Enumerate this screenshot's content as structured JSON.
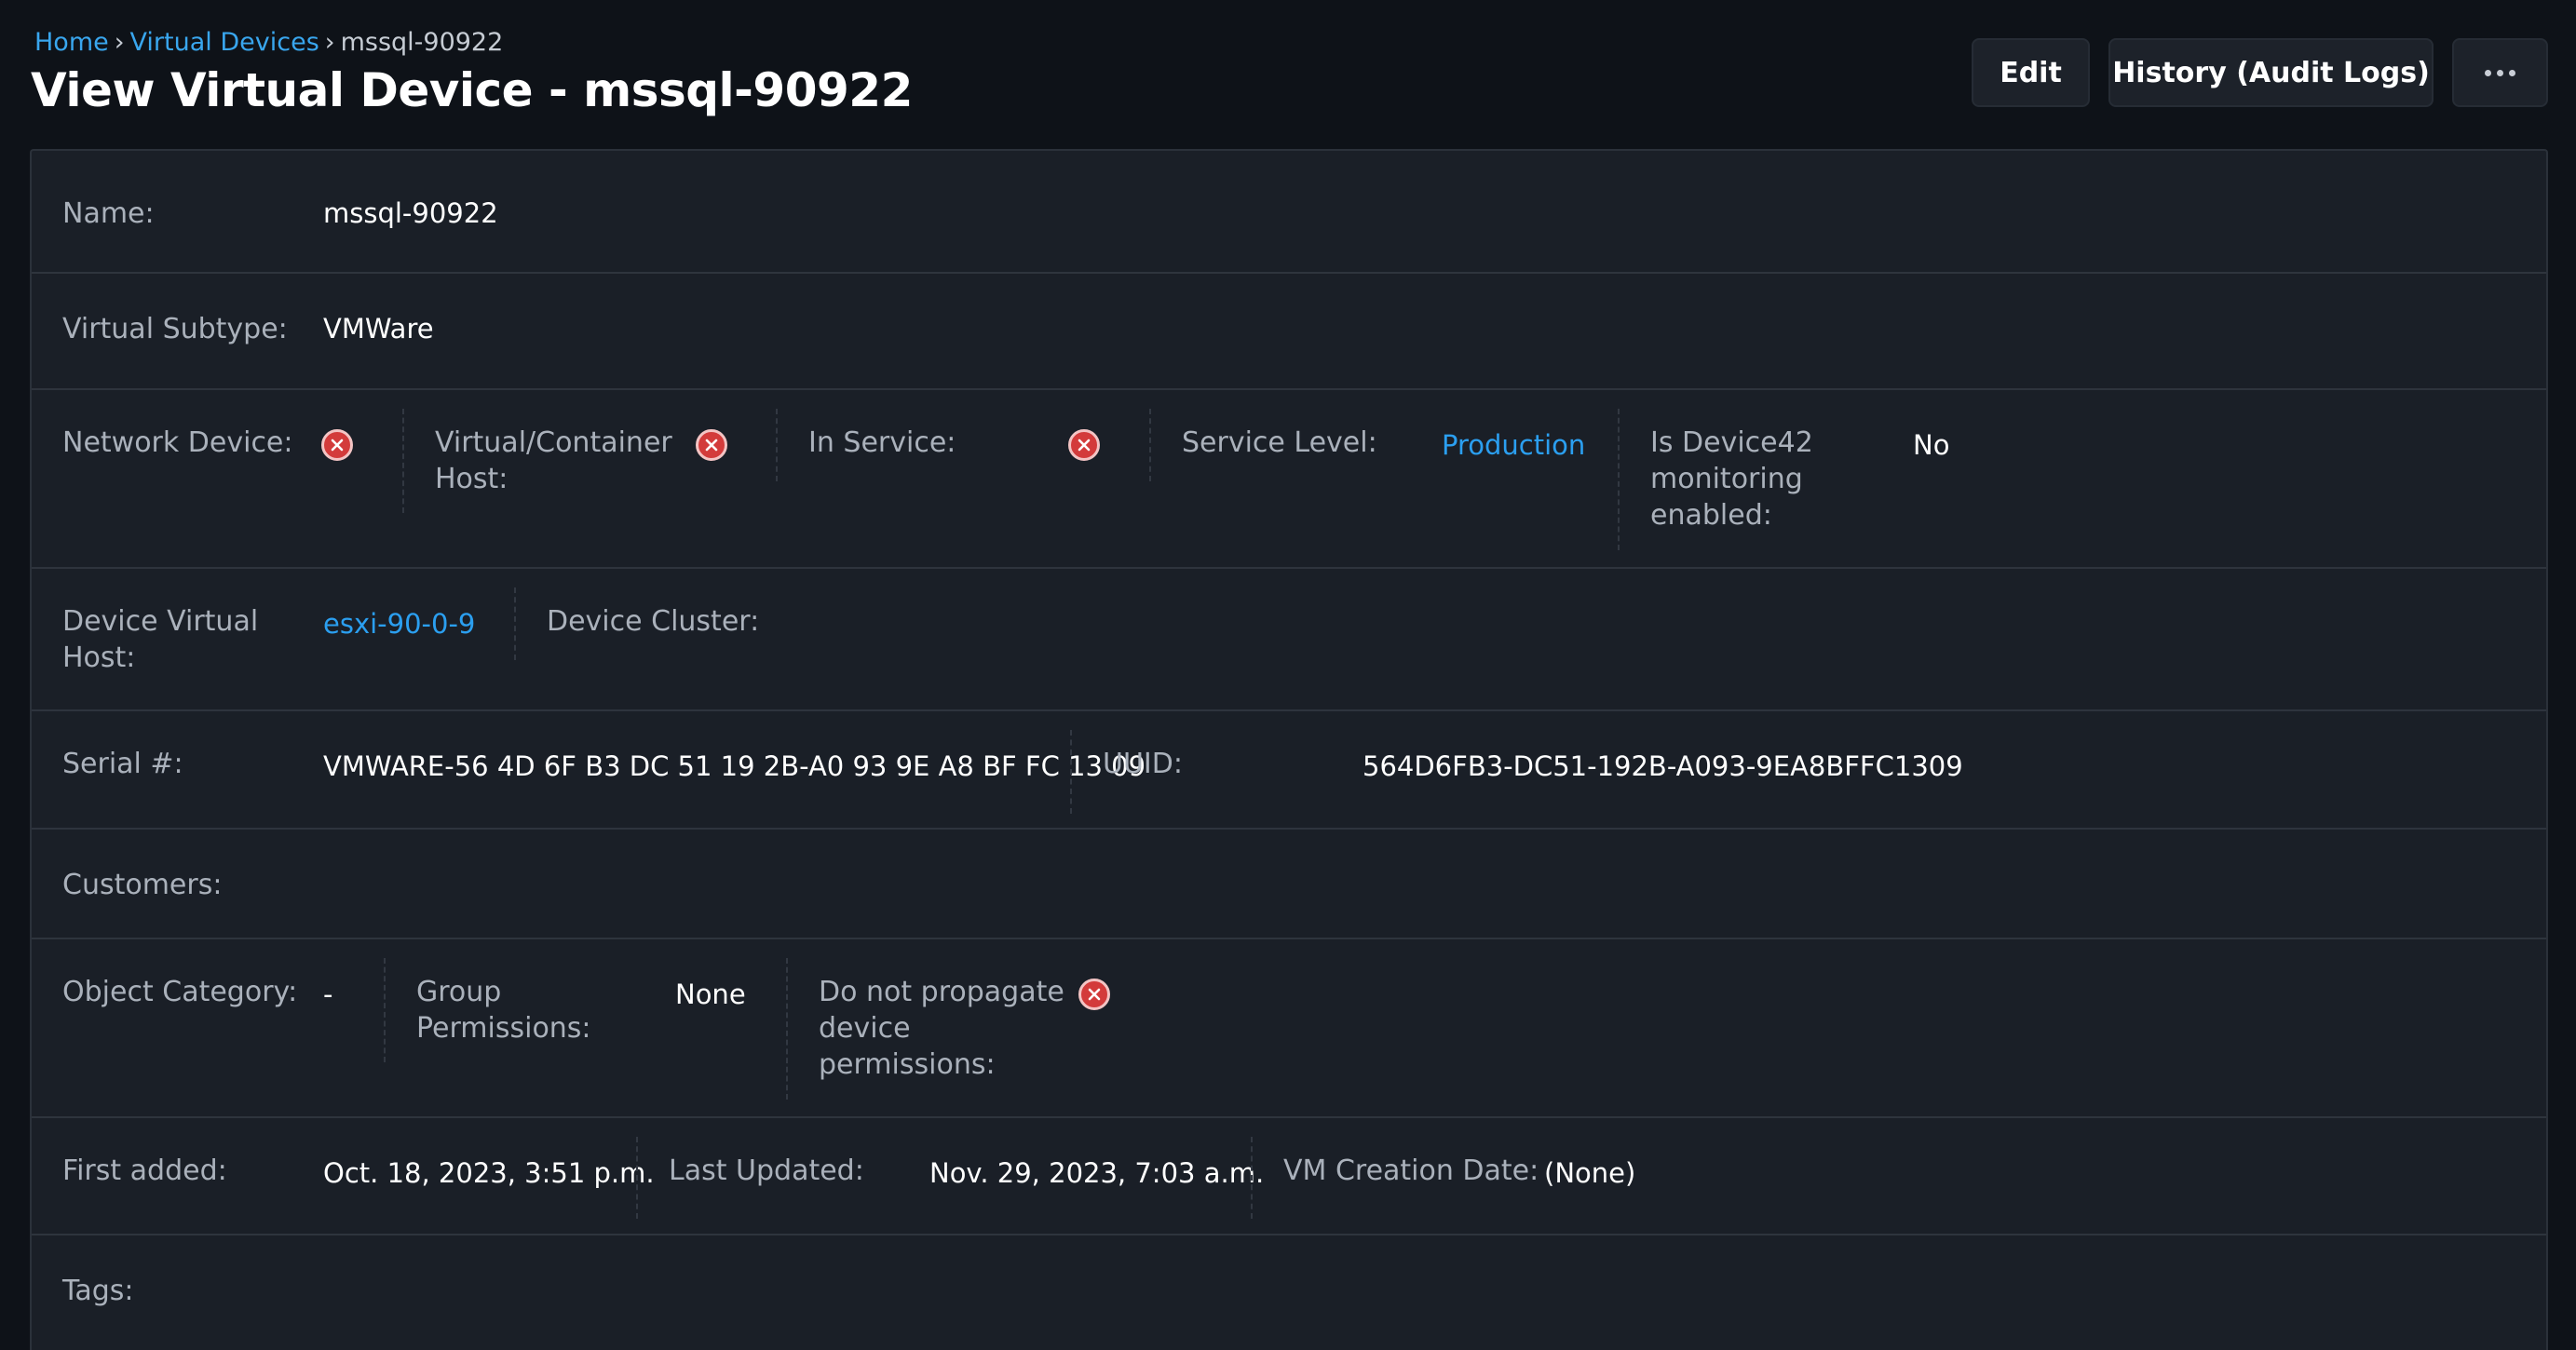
{
  "breadcrumb": {
    "home": "Home",
    "separator": "›",
    "section": "Virtual Devices",
    "current": "mssql-90922"
  },
  "title": "View Virtual Device - mssql-90922",
  "actions": {
    "edit": "Edit",
    "history": "History (Audit Logs)",
    "more_icon": "more-horizontal-icon"
  },
  "fields": {
    "name": {
      "label": "Name:",
      "value": "mssql-90922"
    },
    "virtual_subtype": {
      "label": "Virtual Subtype:",
      "value": "VMWare"
    },
    "network_device": {
      "label": "Network Device:",
      "value": false,
      "icon": "x-circle-icon"
    },
    "virtual_container_host": {
      "label_line1": "Virtual/Container",
      "label_line2": "Host:",
      "value": false,
      "icon": "x-circle-icon"
    },
    "in_service": {
      "label": "In Service:",
      "value": false,
      "icon": "x-circle-icon"
    },
    "service_level": {
      "label": "Service Level:",
      "value": "Production"
    },
    "monitoring": {
      "label_line1": "Is Device42",
      "label_line2": "monitoring",
      "label_line3": "enabled:",
      "value": "No"
    },
    "device_virtual_host": {
      "label_line1": "Device Virtual",
      "label_line2": "Host:",
      "value": "esxi-90-0-9"
    },
    "device_cluster": {
      "label": "Device Cluster:",
      "value": ""
    },
    "serial": {
      "label": "Serial #:",
      "value": "VMWARE-56 4D 6F B3 DC 51 19 2B-A0 93 9E A8 BF FC 13 09"
    },
    "uuid": {
      "label": "UUID:",
      "value": "564D6FB3-DC51-192B-A093-9EA8BFFC1309"
    },
    "customers": {
      "label": "Customers:",
      "value": ""
    },
    "object_category": {
      "label": "Object Category:",
      "value": "-"
    },
    "group_permissions": {
      "label_line1": "Group",
      "label_line2": "Permissions:",
      "value": "None"
    },
    "do_not_propagate": {
      "label_line1": "Do not propagate",
      "label_line2": "device",
      "label_line3": "permissions:",
      "value": false,
      "icon": "x-circle-icon"
    },
    "first_added": {
      "label": "First added:",
      "value": "Oct. 18, 2023, 3:51 p.m."
    },
    "last_updated": {
      "label": "Last Updated:",
      "value": "Nov. 29, 2023, 7:03 a.m."
    },
    "vm_creation_date": {
      "label": "VM Creation Date:",
      "value": "(None)"
    },
    "tags": {
      "label": "Tags:",
      "value": ""
    }
  },
  "colors": {
    "background": "#0e1218",
    "panel": "#1a1f27",
    "link": "#2b9ff0",
    "false_icon": "#d33b3b"
  }
}
